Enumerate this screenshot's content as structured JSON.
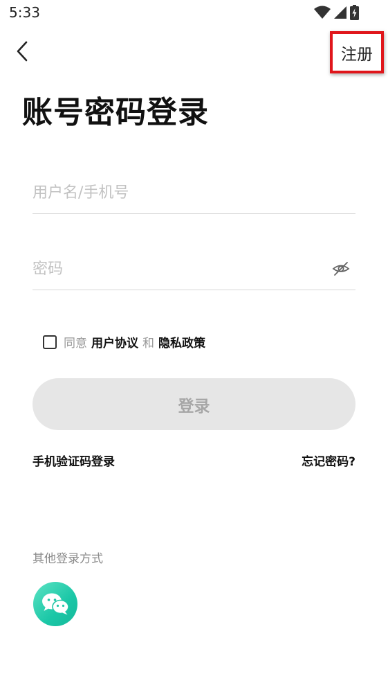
{
  "status_bar": {
    "time": "5:33"
  },
  "header": {
    "register_label": "注册"
  },
  "title": "账号密码登录",
  "form": {
    "username_placeholder": "用户名/手机号",
    "password_placeholder": "密码"
  },
  "agreement": {
    "prefix": "同意",
    "user_agreement": "用户协议",
    "conjunction": "和",
    "privacy_policy": "隐私政策"
  },
  "login_button": "登录",
  "links": {
    "sms_login": "手机验证码登录",
    "forgot_password": "忘记密码?"
  },
  "other_login": {
    "label": "其他登录方式",
    "methods": [
      {
        "icon": "wechat-icon"
      }
    ]
  },
  "colors": {
    "register_highlight": "#e0161b",
    "wechat": "#1bc7a7",
    "login_button_bg": "#e6e6e6"
  }
}
